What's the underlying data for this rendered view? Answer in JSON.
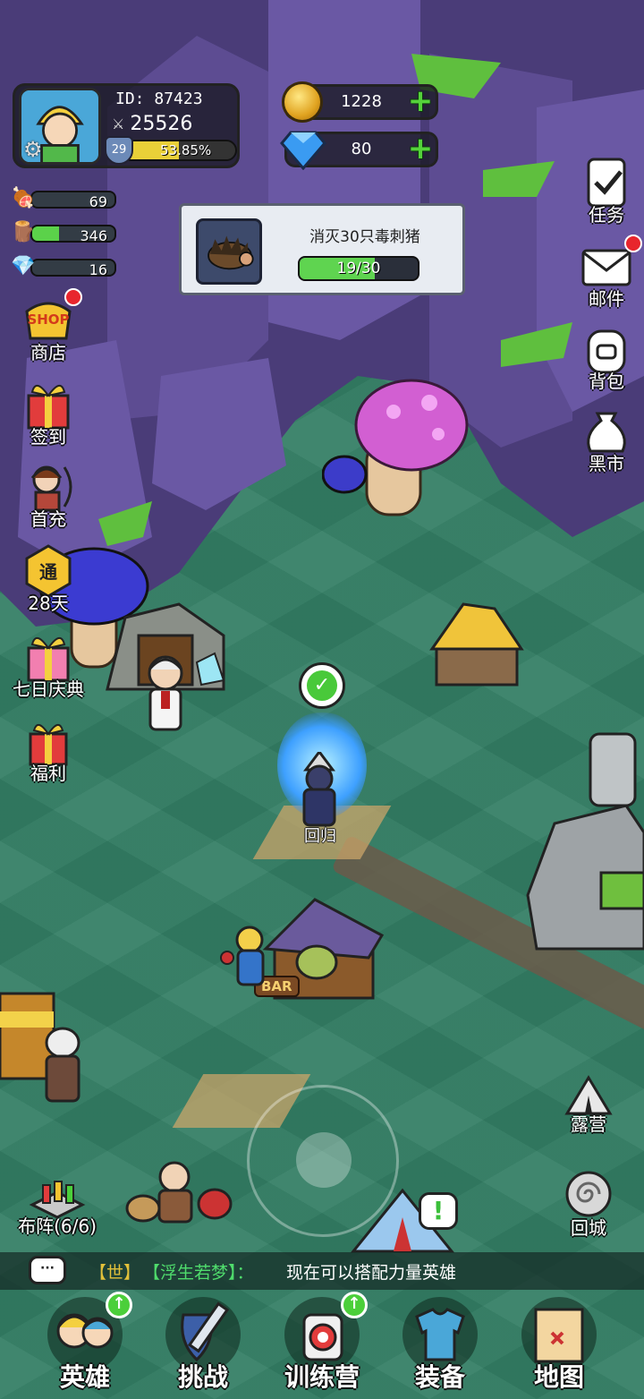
{
  "player": {
    "id_label": "ID: 87423",
    "power": "25526",
    "level": "29",
    "exp_percent": "53.85%",
    "exp_fraction": 0.5385
  },
  "currency": {
    "gold": "1228",
    "gems": "80"
  },
  "resources": [
    {
      "icon": "meat-icon",
      "value": "69",
      "fill": 0.0
    },
    {
      "icon": "wood-icon",
      "value": "346",
      "fill": 0.33
    },
    {
      "icon": "crystal-icon",
      "value": "16",
      "fill": 0.0
    }
  ],
  "quest": {
    "title": "消灭30只毒刺猪",
    "progress_text": "19/30",
    "progress": 0.633
  },
  "left_menu": {
    "shop": "商店",
    "shop_logo": "SHOP",
    "signin": "签到",
    "first_recharge": "首充",
    "pass": "28天",
    "pass_badge": "通",
    "seven_day": "七日庆典",
    "welfare": "福利",
    "formation": "布阵(6/6)"
  },
  "right_menu": {
    "tasks": "任务",
    "mail": "邮件",
    "bag": "背包",
    "black_market": "黑市",
    "camp": "露营",
    "return_city": "回城"
  },
  "map": {
    "portal_label": "回归",
    "bar_sign": "BAR"
  },
  "chat": {
    "channel": "【世】",
    "sender": "【浮生若梦】：",
    "message": "现在可以搭配力量英雄"
  },
  "bottom_nav": {
    "heroes": "英雄",
    "challenge": "挑战",
    "training": "训练营",
    "equipment": "装备",
    "map": "地图"
  },
  "colors": {
    "ground": "#337e64",
    "cliff": "#5a4b8c",
    "moss": "#5fbf3e",
    "progress_green": "#5fd450",
    "exp_yellow": "#e9d038",
    "notify_red": "#e8262d"
  }
}
